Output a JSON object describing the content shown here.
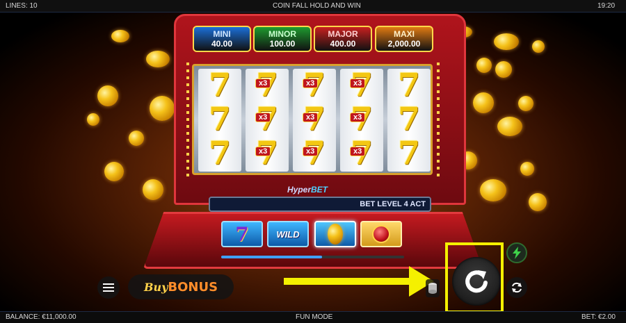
{
  "topbar": {
    "lines": "LINES: 10",
    "title": "COIN FALL HOLD AND WIN",
    "time": "19:20"
  },
  "jackpots": [
    {
      "name": "MINI",
      "value": "40.00",
      "color": "#1b6fd8"
    },
    {
      "name": "MINOR",
      "value": "100.00",
      "color": "#1e9a2f"
    },
    {
      "name": "MAJOR",
      "value": "400.00",
      "color": "#c8201f"
    },
    {
      "name": "MAXI",
      "value": "2,000.00",
      "color": "#e07a12"
    }
  ],
  "reels": {
    "symbol": "7",
    "multiplier": "x3",
    "grid": [
      [
        "7",
        "7x3",
        "7x3",
        "7x3",
        "7"
      ],
      [
        "7",
        "7x3",
        "7x3",
        "7x3",
        "7"
      ],
      [
        "7",
        "7x3",
        "7x3",
        "7x3",
        "7"
      ]
    ]
  },
  "hyperbet": {
    "prefix": "Hyper",
    "suffix": "BET",
    "bet_level_text": "BET LEVEL 4 ACT"
  },
  "hyperbet_buttons": [
    {
      "id": "seven",
      "label": "7"
    },
    {
      "id": "wild",
      "label": "WILD"
    },
    {
      "id": "coin",
      "label": ""
    },
    {
      "id": "gem",
      "label": ""
    }
  ],
  "hyperbet_progress": 0.55,
  "controls": {
    "buy_bonus_a": "Buy",
    "buy_bonus_b": "BONUS"
  },
  "bottombar": {
    "balance": "BALANCE: €11,000.00",
    "mode": "FUN MODE",
    "bet": "BET: €2.00"
  },
  "icons": {
    "menu": "hamburger-menu-icon",
    "spin": "spin-arrow-icon",
    "turbo": "lightning-icon",
    "autoplay": "autoplay-icon",
    "coinstack": "coin-stack-icon"
  },
  "colors": {
    "annotation": "#f5f000",
    "cabinet": "#b0141c"
  }
}
